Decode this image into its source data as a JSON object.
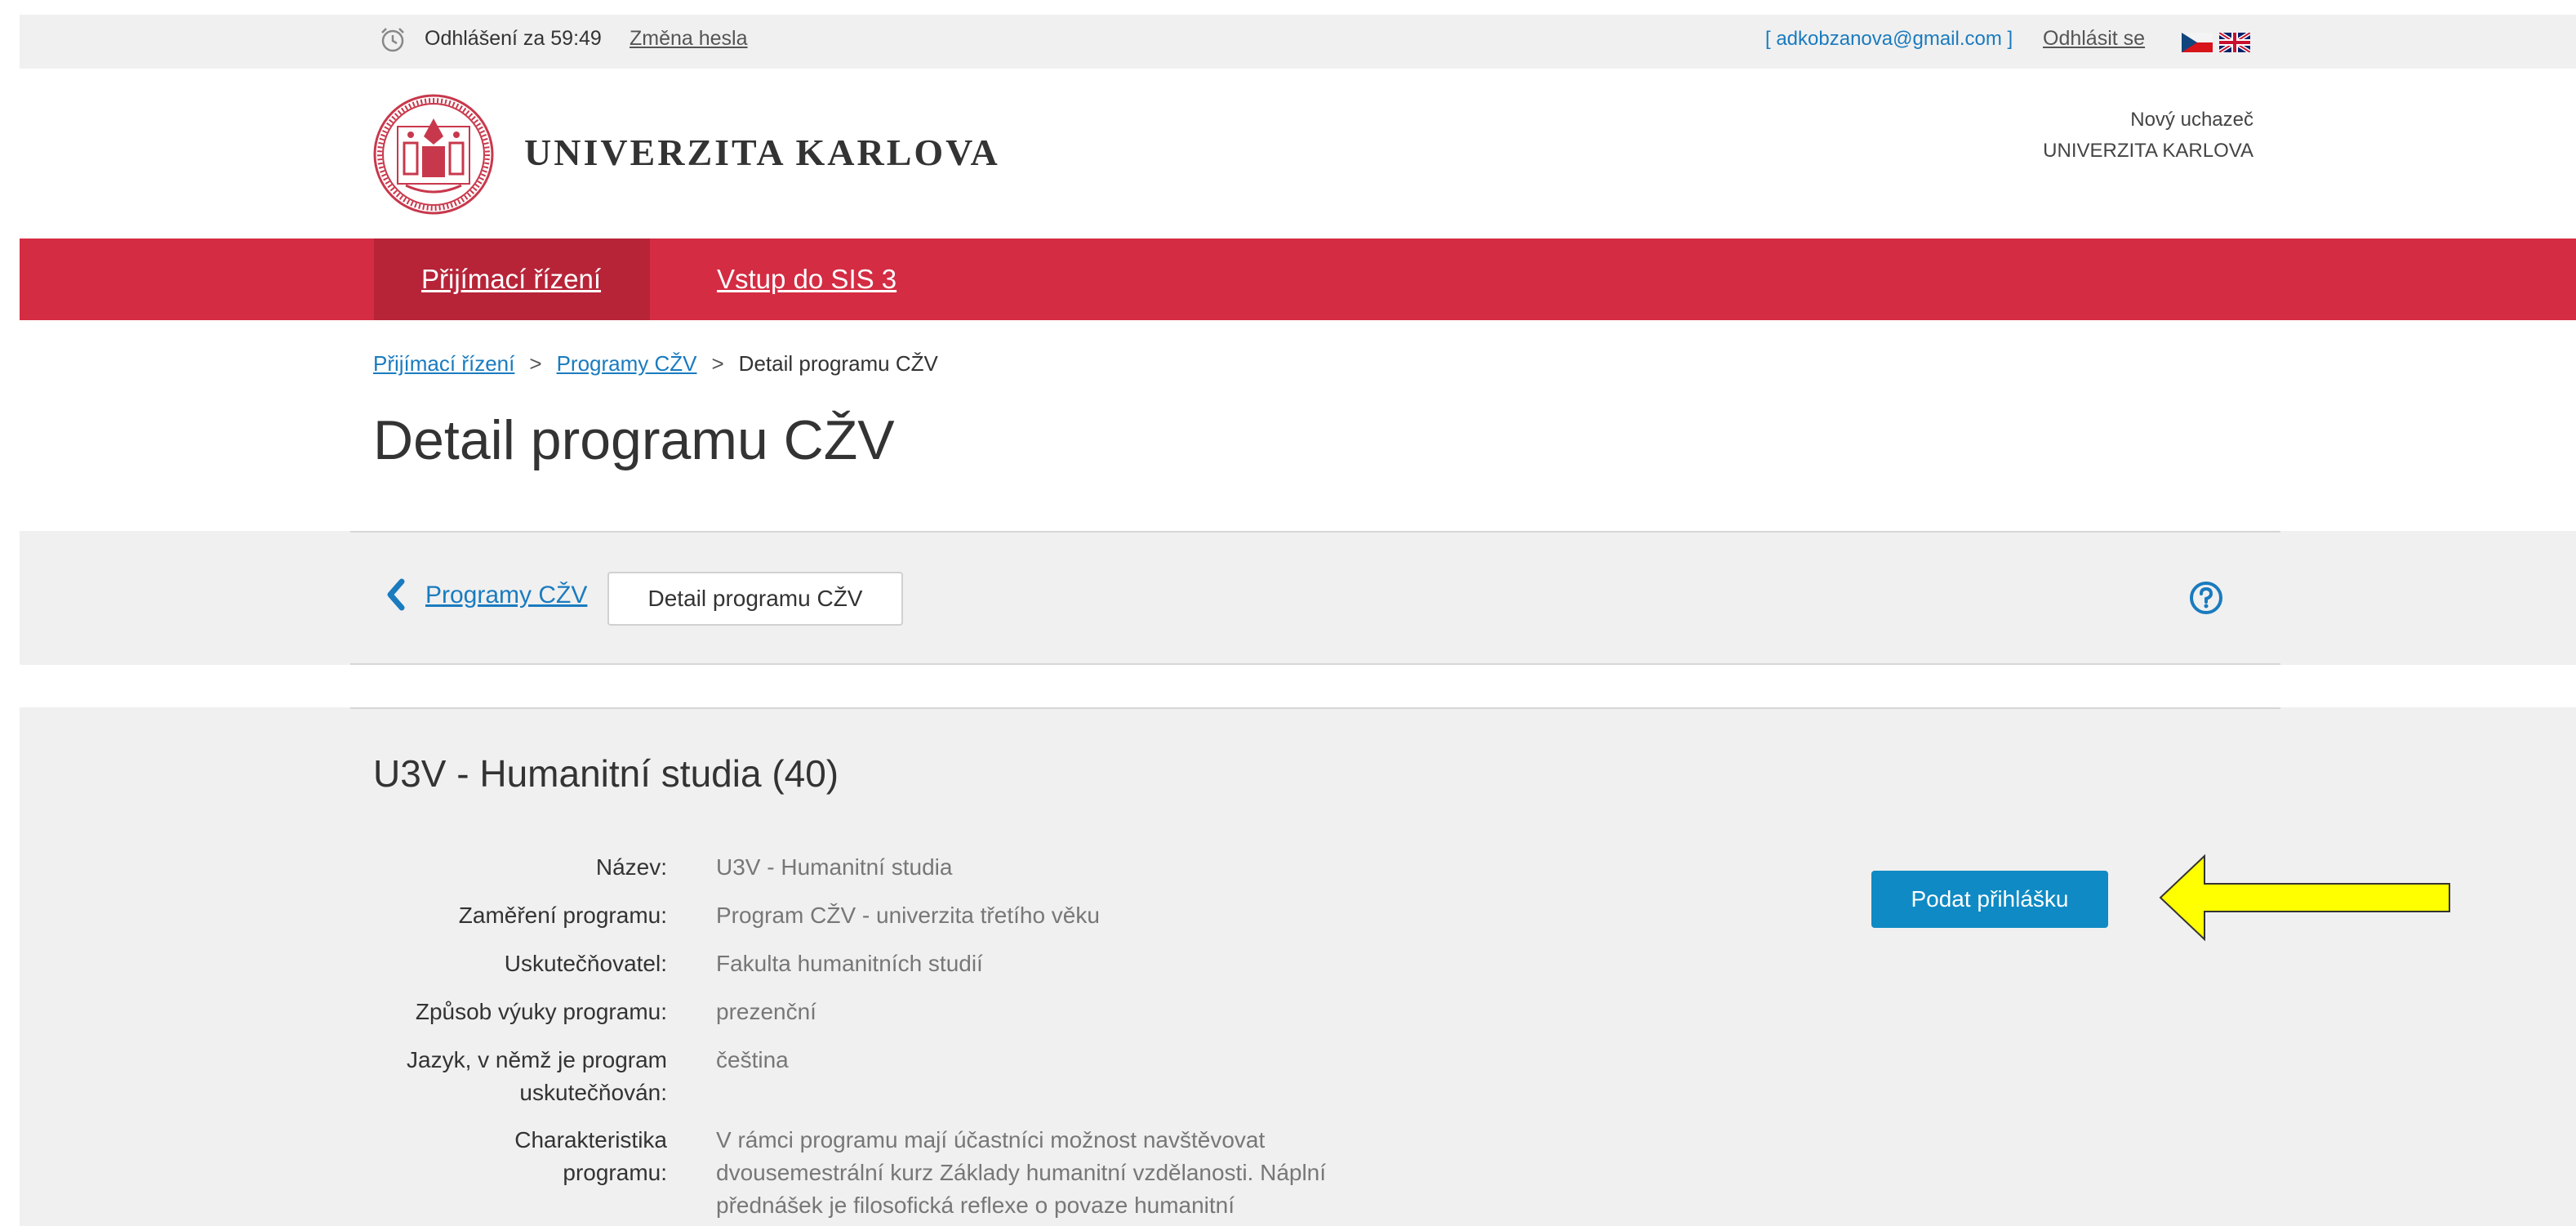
{
  "topbar": {
    "logout_timer": "Odhlášení za 59:49",
    "change_password": "Změna hesla",
    "email": "[ adkobzanova@gmail.com ]",
    "logout": "Odhlásit se"
  },
  "header": {
    "university_name": "UNIVERZITA KARLOVA",
    "role_line1": "Nový uchazeč",
    "role_line2": "UNIVERZITA KARLOVA"
  },
  "nav": {
    "items": [
      {
        "label": "Přijímací řízení",
        "active": true
      },
      {
        "label": "Vstup do SIS 3",
        "active": false
      }
    ]
  },
  "breadcrumb": {
    "items": [
      "Přijímací řízení",
      "Programy CŽV",
      "Detail programu CŽV"
    ],
    "separator": ">"
  },
  "page_title": "Detail programu CŽV",
  "toolbar": {
    "back_label": "Programy CŽV",
    "current_label": "Detail programu CŽV"
  },
  "program": {
    "title": "U3V - Humanitní studia (40)",
    "fields": [
      {
        "label": "Název:",
        "value": "U3V - Humanitní studia"
      },
      {
        "label": "Zaměření programu:",
        "value": "Program CŽV - univerzita třetího věku"
      },
      {
        "label": "Uskutečňovatel:",
        "value": "Fakulta humanitních studií"
      },
      {
        "label": "Způsob výuky programu:",
        "value": "prezenční"
      },
      {
        "label": "Jazyk, v němž je program uskutečňován:",
        "value": "čeština"
      },
      {
        "label": "Charakteristika programu:",
        "value": "V rámci programu mají účastníci možnost navštěvovat dvousemestrální kurz Základy humanitní vzdělanosti. Náplní přednášek je filosofická reflexe o povaze humanitní"
      }
    ],
    "apply_button": "Podat přihlášku"
  },
  "colors": {
    "brand_red": "#d42c43",
    "brand_red_active": "#b72438",
    "link_blue": "#1a7bbf",
    "button_blue": "#0f8ac4",
    "annotation_arrow": "#ffff00"
  }
}
